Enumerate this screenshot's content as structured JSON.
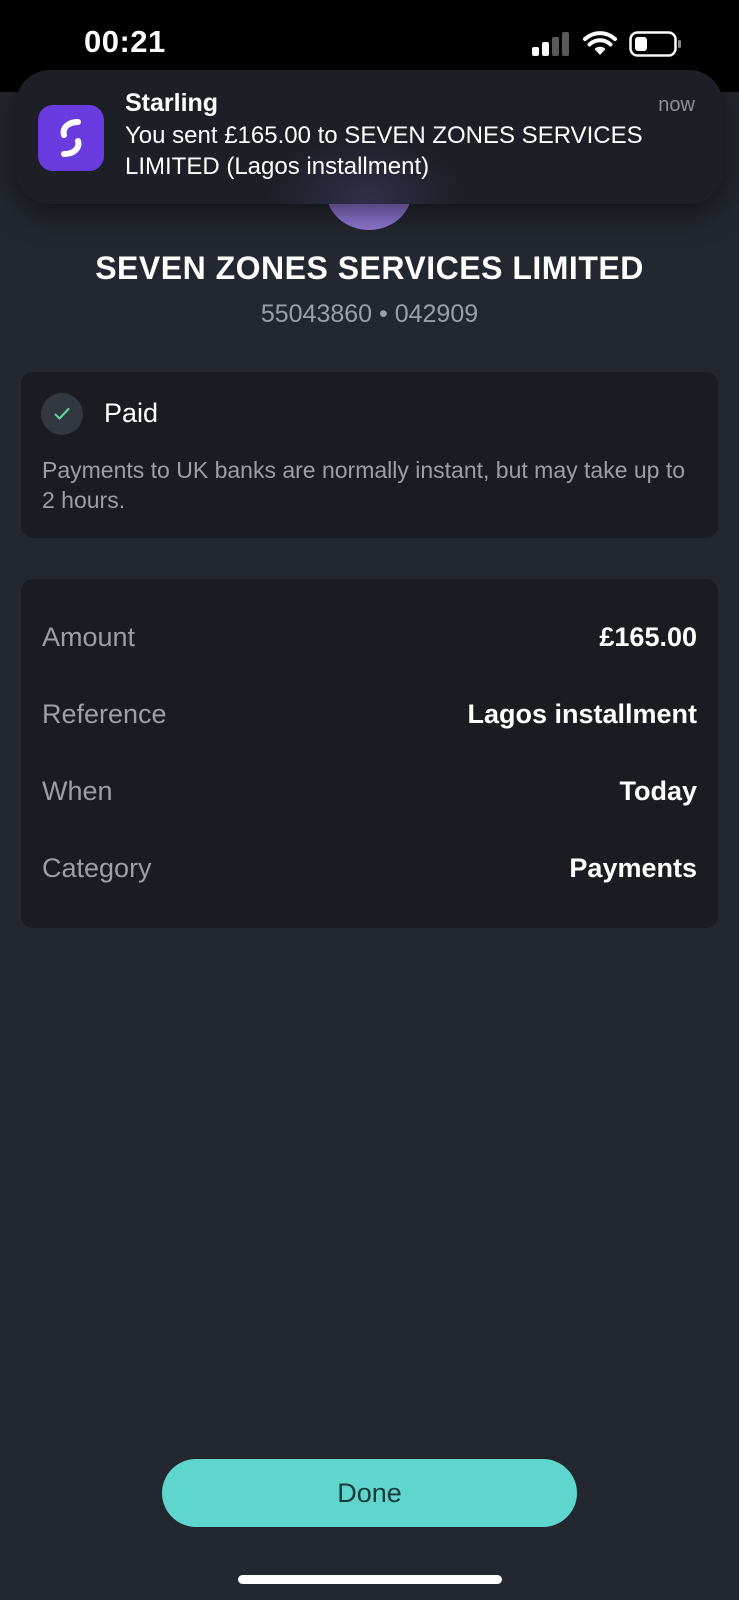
{
  "status_bar": {
    "time": "00:21",
    "signal_icon": "cellular-signal-icon",
    "wifi_icon": "wifi-icon",
    "battery_icon": "battery-icon"
  },
  "notification": {
    "app_name": "Starling",
    "time": "now",
    "message": "You sent £165.00 to SEVEN ZONES SERVICES LIMITED (Lagos installment)",
    "app_icon": "starling-app-icon"
  },
  "payee": {
    "name": "SEVEN ZONES SERVICES LIMITED",
    "account": "55043860 • 042909"
  },
  "status_card": {
    "label": "Paid",
    "description": "Payments to UK banks are normally instant, but may take up to 2 hours.",
    "icon": "check-icon"
  },
  "details": [
    {
      "label": "Amount",
      "value": "£165.00"
    },
    {
      "label": "Reference",
      "value": "Lagos installment"
    },
    {
      "label": "When",
      "value": "Today"
    },
    {
      "label": "Category",
      "value": "Payments"
    }
  ],
  "done_label": "Done",
  "colors": {
    "background": "#23272f",
    "card": "#1a1c21",
    "accent": "#5fd6cd",
    "brand": "#6a3ce0",
    "avatar": "#8e77d4"
  }
}
